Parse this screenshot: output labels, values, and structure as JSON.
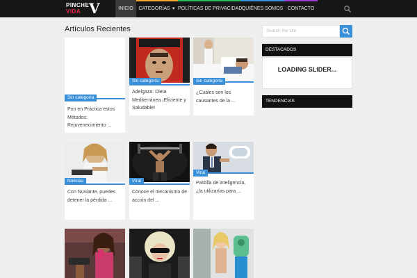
{
  "header": {
    "logo_line1": "PINCHE",
    "logo_line2": "VIDA",
    "logo_mark": "V",
    "nav": [
      {
        "label": "INICIO",
        "active": true
      },
      {
        "label": "CATEGORÍAS",
        "has_dropdown": true
      },
      {
        "label": "POLÍTICAS DE PRIVACIDAD"
      },
      {
        "label": "QUIÉNES SOMOS"
      },
      {
        "label": "CONTACTO"
      }
    ],
    "search_icon": "search-icon"
  },
  "main": {
    "heading": "Artículos Recientes",
    "posts": [
      {
        "category": "Sin categoría",
        "excerpt": "Pon en Práctica estos Métodos: Rejuvenecimiento ..."
      },
      {
        "category": "Sin categoría",
        "excerpt": "Adelgaza: Dieta Mediterránea ¡Eficiente y Saludable!"
      },
      {
        "category": "Sin categoría",
        "excerpt": "¿Cuáles son los causantes de la ..."
      },
      {
        "category": "Noticias",
        "excerpt": "Con Nuviante, puedes detener la pérdida ..."
      },
      {
        "category": "Viral",
        "excerpt": "Conoce el mecanismo de acción del ..."
      },
      {
        "category": "Viral",
        "excerpt": "Pastilla de inteligencia, ¿la utilizarías para ..."
      },
      {
        "category": "",
        "excerpt": ""
      },
      {
        "category": "",
        "excerpt": ""
      },
      {
        "category": "",
        "excerpt": ""
      }
    ]
  },
  "sidebar": {
    "search_placeholder": "Search the site",
    "destacados_title": "DESTACADOS",
    "slider_loading": "LOADING SLIDER...",
    "tendencias_title": "TENDENCIAS"
  },
  "colors": {
    "accent": "#3a8fd9",
    "nav_stripes": [
      "#e8294a",
      "#f2a531",
      "#2dbb5d",
      "#3a8fd9",
      "#9b3fd1"
    ]
  }
}
